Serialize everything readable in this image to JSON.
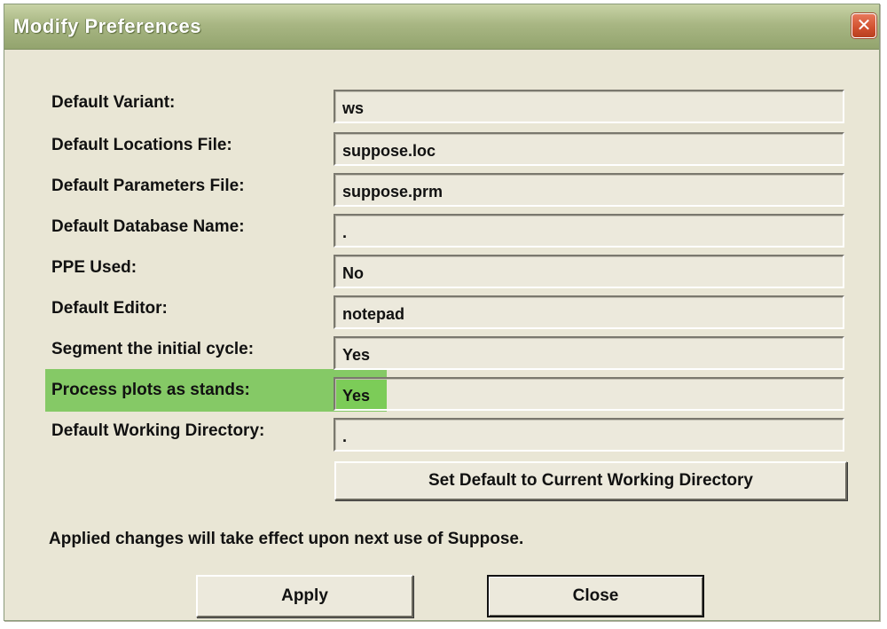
{
  "window": {
    "title": "Modify Preferences",
    "close_glyph": "✕"
  },
  "fields": [
    {
      "label": "Default Variant:",
      "value": "ws"
    },
    {
      "label": "Default Locations File:",
      "value": "suppose.loc"
    },
    {
      "label": "Default Parameters File:",
      "value": "suppose.prm"
    },
    {
      "label": "Default Database Name:",
      "value": "."
    },
    {
      "label": "PPE Used:",
      "value": "No"
    },
    {
      "label": "Default Editor:",
      "value": "notepad"
    },
    {
      "label": "Segment the initial cycle:",
      "value": "Yes"
    },
    {
      "label": "Process plots as stands:",
      "value": "Yes"
    },
    {
      "label": "Default Working Directory:",
      "value": "."
    }
  ],
  "buttons": {
    "set_default": "Set Default to Current Working Directory",
    "apply": "Apply",
    "close": "Close"
  },
  "note": "Applied changes will take effect upon next use of Suppose.",
  "colors": {
    "highlight": "#6cc24a",
    "titlebar": "#a8b683",
    "dialog_bg": "#e9e6d5"
  }
}
